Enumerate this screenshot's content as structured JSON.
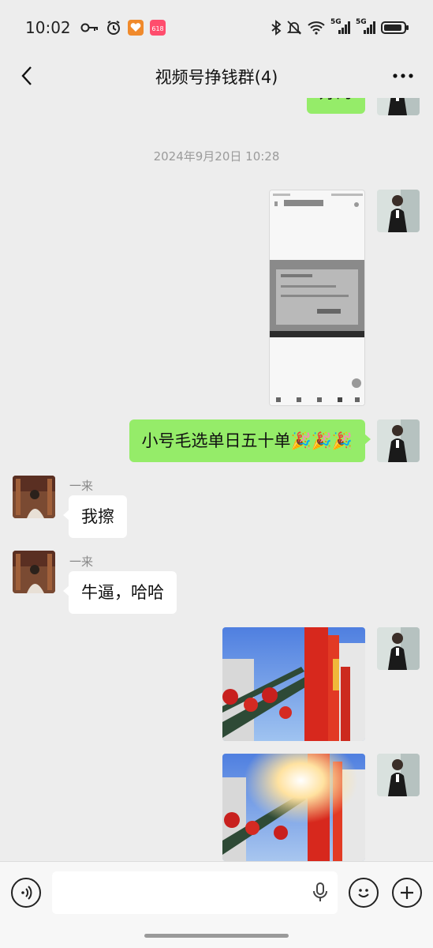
{
  "status_bar": {
    "time": "10:02",
    "network_label_1": "5G",
    "network_label_2": "5G",
    "badge_label": "618",
    "icons": [
      "key-icon",
      "alarm-icon",
      "heart-app-icon",
      "app-618-icon",
      "bluetooth-icon",
      "mute-icon",
      "wifi-icon",
      "signal-icon",
      "battery-icon"
    ]
  },
  "header": {
    "title": "视频号挣钱群(4)",
    "back_icon": "back-arrow-icon",
    "more_icon": "more-dots-icon"
  },
  "chat": {
    "partial_bubble_text": "好的",
    "timestamp": "2024年9月20日 10:28",
    "messages": [
      {
        "type": "image",
        "from": "me",
        "description_icon": "screenshot-image"
      },
      {
        "type": "text",
        "from": "me",
        "text": "小号毛选单日五十单🎉🎉🎉"
      },
      {
        "type": "text",
        "from": "other",
        "sender": "一来",
        "text": "我擦"
      },
      {
        "type": "text",
        "from": "other",
        "sender": "一来",
        "text": "牛逼，哈哈"
      },
      {
        "type": "image",
        "from": "me",
        "description_icon": "street-photo"
      },
      {
        "type": "image",
        "from": "me",
        "description_icon": "street-photo-sun"
      }
    ]
  },
  "input_bar": {
    "voice_icon": "voice-toggle-icon",
    "mic_icon": "microphone-icon",
    "emoji_icon": "emoji-icon",
    "plus_icon": "plus-icon"
  },
  "colors": {
    "background": "#ededed",
    "bubble_me": "#95ec69",
    "bubble_other": "#ffffff"
  }
}
